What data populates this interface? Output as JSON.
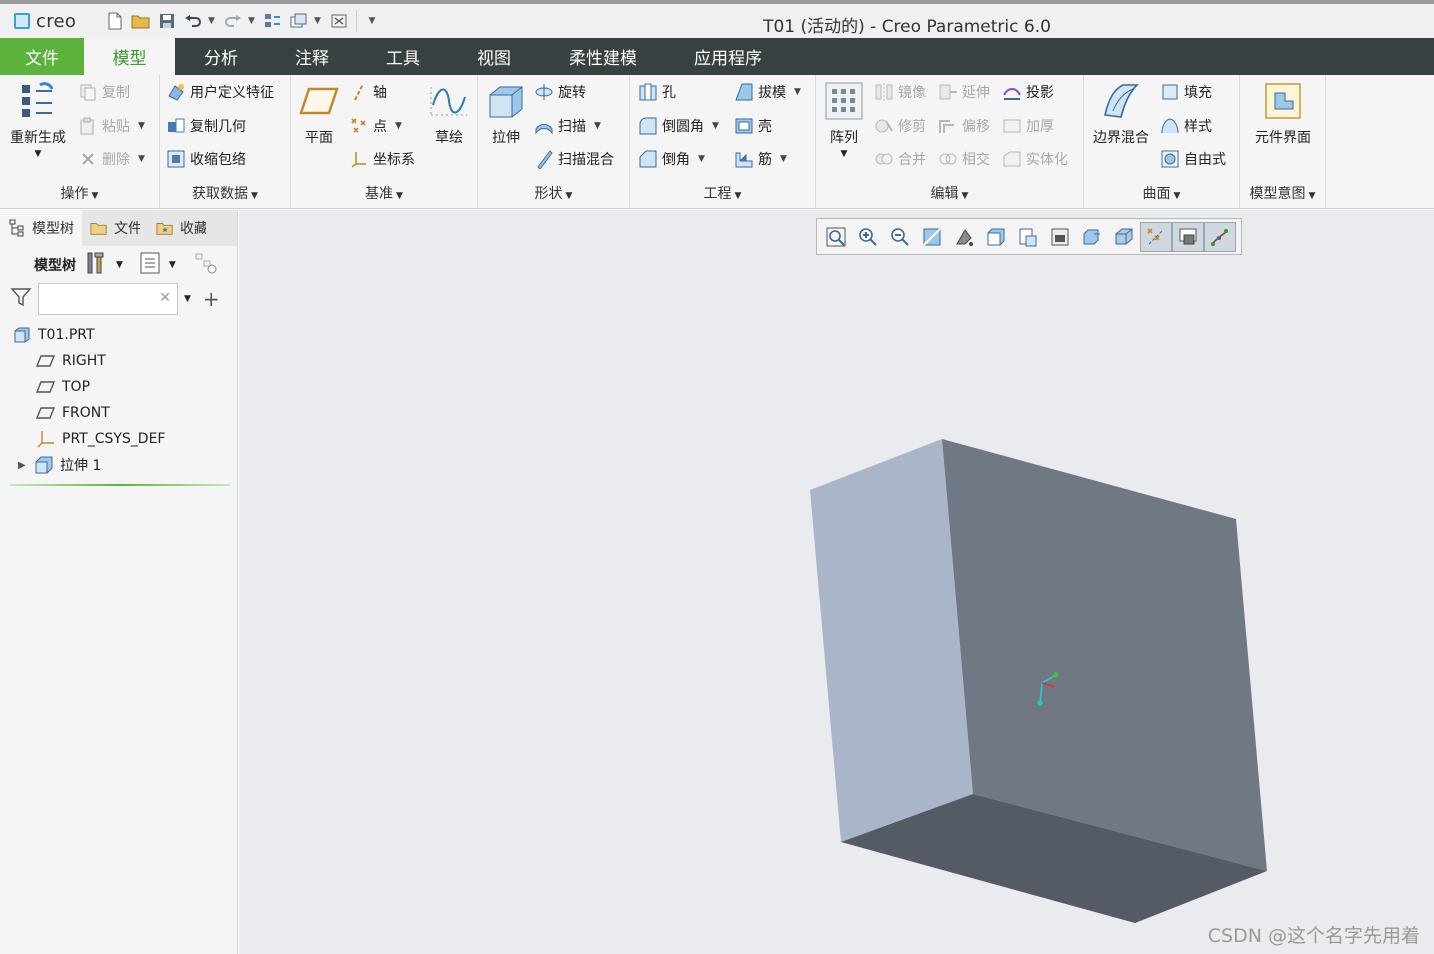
{
  "window": {
    "app_logo": "creo",
    "title": "T01 (活动的) - Creo Parametric 6.0"
  },
  "tabs": [
    {
      "label": "文件"
    },
    {
      "label": "模型"
    },
    {
      "label": "分析"
    },
    {
      "label": "注释"
    },
    {
      "label": "工具"
    },
    {
      "label": "视图"
    },
    {
      "label": "柔性建模"
    },
    {
      "label": "应用程序"
    }
  ],
  "ribbon": {
    "operations": {
      "label": "操作",
      "regenerate": "重新生成",
      "copy": "复制",
      "paste": "粘贴",
      "delete": "删除"
    },
    "get_data": {
      "label": "获取数据",
      "udf": "用户定义特征",
      "copy_geom": "复制几何",
      "shrinkwrap": "收缩包络"
    },
    "datum": {
      "label": "基准",
      "plane": "平面",
      "axis": "轴",
      "point": "点",
      "csys": "坐标系",
      "sketch": "草绘"
    },
    "shapes": {
      "label": "形状",
      "extrude": "拉伸",
      "revolve": "旋转",
      "sweep": "扫描",
      "swept_blend": "扫描混合"
    },
    "engineering": {
      "label": "工程",
      "hole": "孔",
      "round": "倒圆角",
      "chamfer": "倒角",
      "draft": "拔模",
      "shell": "壳",
      "rib": "筋"
    },
    "editing": {
      "label": "编辑",
      "pattern": "阵列",
      "mirror": "镜像",
      "extend": "延伸",
      "project": "投影",
      "trim": "修剪",
      "offset": "偏移",
      "thicken": "加厚",
      "merge": "合并",
      "intersect": "相交",
      "solidify": "实体化"
    },
    "surfaces": {
      "label": "曲面",
      "boundary_blend": "边界混合",
      "fill": "填充",
      "style": "样式",
      "freestyle": "自由式"
    },
    "model_intent": {
      "label": "模型意图",
      "component_interface": "元件界面"
    }
  },
  "left_panel": {
    "tabs": [
      {
        "label": "模型树"
      },
      {
        "label": "文件"
      },
      {
        "label": "收藏"
      }
    ],
    "tree_label": "模型树",
    "search_placeholder": "",
    "tree": [
      {
        "label": "T01.PRT",
        "icon": "part-icon"
      },
      {
        "label": "RIGHT",
        "icon": "datum-plane-icon"
      },
      {
        "label": "TOP",
        "icon": "datum-plane-icon"
      },
      {
        "label": "FRONT",
        "icon": "datum-plane-icon"
      },
      {
        "label": "PRT_CSYS_DEF",
        "icon": "csys-icon"
      },
      {
        "label": "拉伸 1",
        "icon": "extrude-icon"
      }
    ]
  },
  "graphics": {
    "watermark": "CSDN @这个名字先用着"
  },
  "colors": {
    "file_tab": "#5bb33d",
    "tab_bar": "#374142",
    "active_tab_text": "#3a9a2a",
    "viewport_bg": "#e9ebee",
    "face_left": "#a9b5c8",
    "face_front": "#6f7883",
    "face_bottom": "#545b65"
  }
}
